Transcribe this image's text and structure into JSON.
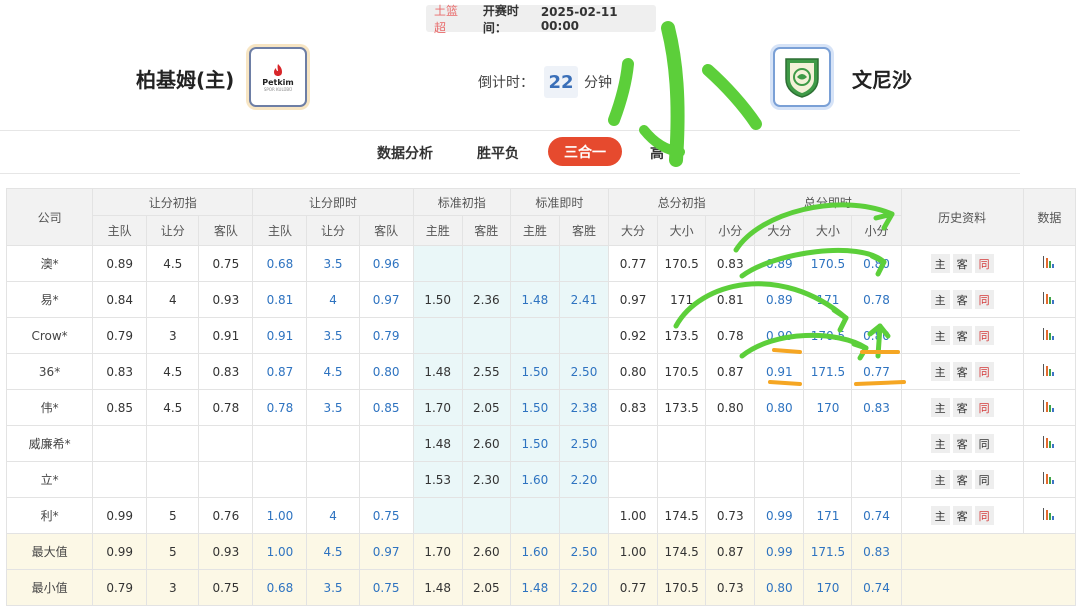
{
  "match": {
    "league": "土篮超",
    "start_label": "开赛时间：",
    "start_time": "2025-02-11 00:00"
  },
  "home": {
    "name": "柏基姆(主)",
    "logo_text": "Petkim",
    "logo_sub": "SPOR KULÜBÜ"
  },
  "away": {
    "name": "文尼沙"
  },
  "countdown": {
    "label": "倒计时：",
    "value": "22",
    "unit": "分钟"
  },
  "tabs": [
    {
      "label": "数据分析"
    },
    {
      "label": "胜平负"
    },
    {
      "label": "三合一",
      "active": true
    },
    {
      "label": "高"
    }
  ],
  "handwriting_text": "小",
  "table": {
    "group_headers": [
      "公司",
      "让分初指",
      "让分即时",
      "标准初指",
      "标准即时",
      "总分初指",
      "总分即时",
      "历史资料",
      "数据"
    ],
    "sub_headers": [
      "主队",
      "让分",
      "客队",
      "主队",
      "让分",
      "客队",
      "主胜",
      "客胜",
      "主胜",
      "客胜",
      "大分",
      "大小",
      "小分",
      "大分",
      "大小",
      "小分"
    ],
    "history_buttons": [
      "主",
      "客",
      "同"
    ],
    "rows": [
      {
        "company": "澳*",
        "cells": [
          "0.89",
          "4.5",
          "0.75",
          "0.68",
          "3.5",
          "0.96",
          "",
          "",
          "",
          "",
          "0.77",
          "170.5",
          "0.83",
          "0.89",
          "170.5",
          "0.80"
        ],
        "same_red": true
      },
      {
        "company": "易*",
        "cells": [
          "0.84",
          "4",
          "0.93",
          "0.81",
          "4",
          "0.97",
          "1.50",
          "2.36",
          "1.48",
          "2.41",
          "0.97",
          "171",
          "0.81",
          "0.89",
          "171",
          "0.78"
        ],
        "same_red": true
      },
      {
        "company": "Crow*",
        "cells": [
          "0.79",
          "3",
          "0.91",
          "0.91",
          "3.5",
          "0.79",
          "",
          "",
          "",
          "",
          "0.92",
          "173.5",
          "0.78",
          "0.90",
          "170.5",
          "0.80"
        ],
        "same_red": true
      },
      {
        "company": "36*",
        "cells": [
          "0.83",
          "4.5",
          "0.83",
          "0.87",
          "4.5",
          "0.80",
          "1.48",
          "2.55",
          "1.50",
          "2.50",
          "0.80",
          "170.5",
          "0.87",
          "0.91",
          "171.5",
          "0.77"
        ],
        "same_red": true
      },
      {
        "company": "伟*",
        "cells": [
          "0.85",
          "4.5",
          "0.78",
          "0.78",
          "3.5",
          "0.85",
          "1.70",
          "2.05",
          "1.50",
          "2.38",
          "0.83",
          "173.5",
          "0.80",
          "0.80",
          "170",
          "0.83"
        ],
        "same_red": true
      },
      {
        "company": "威廉希*",
        "cells": [
          "",
          "",
          "",
          "",
          "",
          "",
          "1.48",
          "2.60",
          "1.50",
          "2.50",
          "",
          "",
          "",
          "",
          "",
          ""
        ],
        "same_red": false
      },
      {
        "company": "立*",
        "cells": [
          "",
          "",
          "",
          "",
          "",
          "",
          "1.53",
          "2.30",
          "1.60",
          "2.20",
          "",
          "",
          "",
          "",
          "",
          ""
        ],
        "same_red": false
      },
      {
        "company": "利*",
        "cells": [
          "0.99",
          "5",
          "0.76",
          "1.00",
          "4",
          "0.75",
          "",
          "",
          "",
          "",
          "1.00",
          "174.5",
          "0.73",
          "0.99",
          "171",
          "0.74"
        ],
        "same_red": true
      }
    ],
    "summary": [
      {
        "label": "最大值",
        "cells": [
          "0.99",
          "5",
          "0.93",
          "1.00",
          "4.5",
          "0.97",
          "1.70",
          "2.60",
          "1.60",
          "2.50",
          "1.00",
          "174.5",
          "0.87",
          "0.99",
          "171.5",
          "0.83"
        ]
      },
      {
        "label": "最小值",
        "cells": [
          "0.79",
          "3",
          "0.75",
          "0.68",
          "3.5",
          "0.75",
          "1.48",
          "2.05",
          "1.48",
          "2.20",
          "0.77",
          "170.5",
          "0.73",
          "0.80",
          "170",
          "0.74"
        ]
      }
    ]
  },
  "colors": {
    "accent": "#e64a2e",
    "live_blue": "#2e73c0",
    "highlight": "#eaf7f8",
    "summary_bg": "#fcf8e6",
    "marker_green": "#5ccf3a",
    "marker_orange": "#f5a623"
  }
}
